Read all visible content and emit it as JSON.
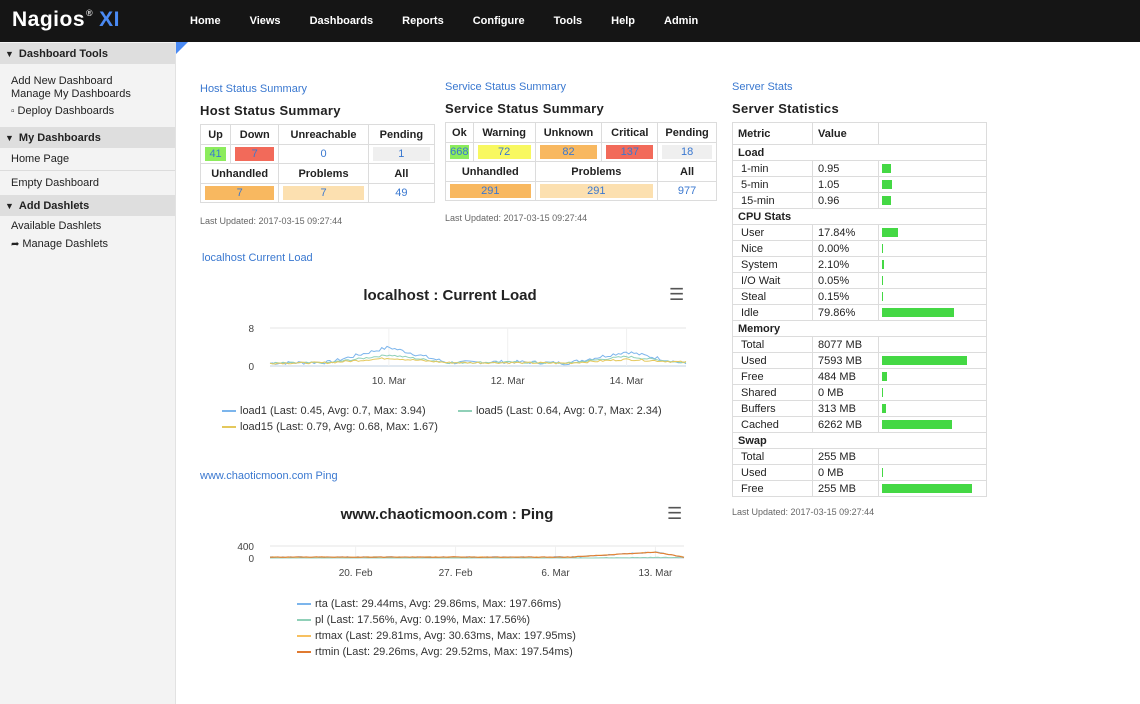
{
  "topbar": {
    "logo_main": "Nagios",
    "logo_reg": "®",
    "logo_xi": "XI",
    "nav": [
      "Home",
      "Views",
      "Dashboards",
      "Reports",
      "Configure",
      "Tools",
      "Help",
      "Admin"
    ]
  },
  "sidebar": {
    "dashboard_tools": {
      "heading": "Dashboard Tools",
      "items": [
        "Add New Dashboard",
        "Manage My Dashboards",
        "Deploy Dashboards"
      ]
    },
    "my_dashboards": {
      "heading": "My Dashboards",
      "items": [
        "Home Page",
        "Empty Dashboard"
      ]
    },
    "add_dashlets": {
      "heading": "Add Dashlets",
      "items": [
        "Available Dashlets",
        "Manage Dashlets"
      ]
    }
  },
  "host_status": {
    "link": "Host Status Summary",
    "heading": "Host Status Summary",
    "headers": [
      "Up",
      "Down",
      "Unreachable",
      "Pending"
    ],
    "values": [
      "41",
      "7",
      "0",
      "1"
    ],
    "headers2": [
      "Unhandled",
      "Problems",
      "All"
    ],
    "values2": [
      "7",
      "7",
      "49"
    ],
    "updated": "Last Updated: 2017-03-15 09:27:44"
  },
  "service_status": {
    "link": "Service Status Summary",
    "heading": "Service Status Summary",
    "headers": [
      "Ok",
      "Warning",
      "Unknown",
      "Critical",
      "Pending"
    ],
    "values": [
      "668",
      "72",
      "82",
      "137",
      "18"
    ],
    "headers2": [
      "Unhandled",
      "Problems",
      "All"
    ],
    "values2": [
      "291",
      "291",
      "977"
    ],
    "updated": "Last Updated: 2017-03-15 09:27:44"
  },
  "server_stats": {
    "link": "Server Stats",
    "heading": "Server Statistics",
    "col_metric": "Metric",
    "col_value": "Value",
    "sections": [
      {
        "name": "Load",
        "rows": [
          {
            "metric": "1-min",
            "value": "0.95",
            "bar": 0.1
          },
          {
            "metric": "5-min",
            "value": "1.05",
            "bar": 0.11
          },
          {
            "metric": "15-min",
            "value": "0.96",
            "bar": 0.1
          }
        ]
      },
      {
        "name": "CPU Stats",
        "rows": [
          {
            "metric": "User",
            "value": "17.84%",
            "bar": 0.18
          },
          {
            "metric": "Nice",
            "value": "0.00%",
            "bar": 0.0
          },
          {
            "metric": "System",
            "value": "2.10%",
            "bar": 0.021
          },
          {
            "metric": "I/O Wait",
            "value": "0.05%",
            "bar": 0.0005
          },
          {
            "metric": "Steal",
            "value": "0.15%",
            "bar": 0.0015
          },
          {
            "metric": "Idle",
            "value": "79.86%",
            "bar": 0.7986
          }
        ]
      },
      {
        "name": "Memory",
        "rows": [
          {
            "metric": "Total",
            "value": "8077 MB",
            "bar": null
          },
          {
            "metric": "Used",
            "value": "7593 MB",
            "bar": 0.94
          },
          {
            "metric": "Free",
            "value": "484 MB",
            "bar": 0.06
          },
          {
            "metric": "Shared",
            "value": "0 MB",
            "bar": 0.0
          },
          {
            "metric": "Buffers",
            "value": "313 MB",
            "bar": 0.04
          },
          {
            "metric": "Cached",
            "value": "6262 MB",
            "bar": 0.78
          }
        ]
      },
      {
        "name": "Swap",
        "rows": [
          {
            "metric": "Total",
            "value": "255 MB",
            "bar": null
          },
          {
            "metric": "Used",
            "value": "0 MB",
            "bar": 0.0
          },
          {
            "metric": "Free",
            "value": "255 MB",
            "bar": 1.0
          }
        ]
      }
    ],
    "updated": "Last Updated: 2017-03-15 09:27:44"
  },
  "load_chart": {
    "link": "localhost Current Load",
    "title": "localhost : Current Load",
    "menu_icon": "hamburger-menu-icon",
    "legend": [
      "load1 (Last: 0.45, Avg: 0.7, Max: 3.94)",
      "load5 (Last: 0.64, Avg: 0.7, Max: 2.34)",
      "load15 (Last: 0.79, Avg: 0.68, Max: 1.67)"
    ]
  },
  "ping_chart": {
    "link": "www.chaoticmoon.com Ping",
    "title": "www.chaoticmoon.com : Ping",
    "menu_icon": "hamburger-menu-icon",
    "legend": [
      "rta (Last: 29.44ms, Avg: 29.86ms, Max: 197.66ms)",
      "pl (Last: 17.56%, Avg: 0.19%, Max: 17.56%)",
      "rtmax (Last: 29.81ms, Avg: 30.63ms, Max: 197.95ms)",
      "rtmin (Last: 29.26ms, Avg: 29.52ms, Max: 197.54ms)"
    ]
  },
  "chart_data": [
    {
      "type": "line",
      "title": "localhost : Current Load",
      "xlabel": "",
      "ylabel": "",
      "x_tick_labels": [
        "10. Mar",
        "12. Mar",
        "14. Mar"
      ],
      "y_tick_labels": [
        "0",
        "8"
      ],
      "ylim": [
        0,
        8
      ],
      "x_range": [
        "2017-03-08",
        "2017-03-15"
      ],
      "grid": true,
      "legend_position": "bottom",
      "colors": {
        "load1": "#7cb5ec",
        "load5": "#90d0b8",
        "load15": "#e4c85c"
      },
      "series": [
        {
          "name": "load1",
          "x": [
            "2017-03-08",
            "2017-03-09",
            "2017-03-10",
            "2017-03-11",
            "2017-03-12",
            "2017-03-13",
            "2017-03-14",
            "2017-03-15"
          ],
          "values": [
            0.6,
            0.8,
            3.94,
            0.7,
            0.9,
            0.6,
            3.0,
            0.45
          ]
        },
        {
          "name": "load5",
          "x": [
            "2017-03-08",
            "2017-03-09",
            "2017-03-10",
            "2017-03-11",
            "2017-03-12",
            "2017-03-13",
            "2017-03-14",
            "2017-03-15"
          ],
          "values": [
            0.6,
            0.7,
            2.34,
            0.7,
            0.8,
            0.6,
            2.0,
            0.64
          ]
        },
        {
          "name": "load15",
          "x": [
            "2017-03-08",
            "2017-03-09",
            "2017-03-10",
            "2017-03-11",
            "2017-03-12",
            "2017-03-13",
            "2017-03-14",
            "2017-03-15"
          ],
          "values": [
            0.6,
            0.7,
            1.67,
            0.7,
            0.7,
            0.6,
            1.4,
            0.79
          ]
        }
      ]
    },
    {
      "type": "line",
      "title": "www.chaoticmoon.com : Ping",
      "xlabel": "",
      "ylabel": "",
      "x_tick_labels": [
        "20. Feb",
        "27. Feb",
        "6. Mar",
        "13. Mar"
      ],
      "y_tick_labels": [
        "0",
        "400"
      ],
      "ylim": [
        0,
        400
      ],
      "x_range": [
        "2017-02-14",
        "2017-03-15"
      ],
      "grid": true,
      "legend_position": "bottom",
      "colors": {
        "rta": "#7cb5ec",
        "pl": "#90d0b8",
        "rtmax": "#f7c060",
        "rtmin": "#e07a30"
      },
      "series": [
        {
          "name": "rta",
          "x": [
            "2017-02-14",
            "2017-02-21",
            "2017-02-28",
            "2017-03-07",
            "2017-03-13",
            "2017-03-15"
          ],
          "values": [
            29.9,
            29.8,
            29.9,
            29.9,
            197.66,
            29.44
          ]
        },
        {
          "name": "pl",
          "x": [
            "2017-02-14",
            "2017-02-21",
            "2017-02-28",
            "2017-03-07",
            "2017-03-13",
            "2017-03-15"
          ],
          "values": [
            0,
            0,
            0,
            0,
            17.56,
            17.56
          ]
        },
        {
          "name": "rtmax",
          "x": [
            "2017-02-14",
            "2017-02-21",
            "2017-02-28",
            "2017-03-07",
            "2017-03-13",
            "2017-03-15"
          ],
          "values": [
            30.6,
            30.5,
            30.7,
            30.6,
            197.95,
            29.81
          ]
        },
        {
          "name": "rtmin",
          "x": [
            "2017-02-14",
            "2017-02-21",
            "2017-02-28",
            "2017-03-07",
            "2017-03-13",
            "2017-03-15"
          ],
          "values": [
            29.5,
            29.5,
            29.6,
            29.5,
            197.54,
            29.26
          ]
        }
      ]
    }
  ]
}
